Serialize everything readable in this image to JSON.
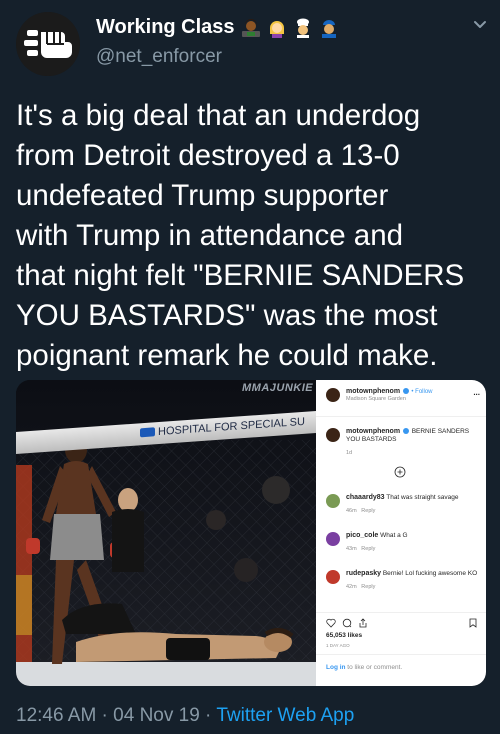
{
  "author": {
    "display_name": "Working Class",
    "handle": "@net_enforcer",
    "name_emojis": [
      "woman-office-worker-emoji",
      "person-emoji",
      "cook-emoji",
      "mechanic-emoji"
    ]
  },
  "tweet": {
    "text": "It's a big deal that an underdog\nfrom Detroit destroyed a 13-0\nundefeated Trump supporter\nwith Trump in attendance and\nthat night felt \"BERNIE SANDERS\nYOU BASTARDS\" was the most\npoignant remark he could make.",
    "timestamp": "12:46 AM · 04 Nov 19",
    "separator": " · ",
    "source": "Twitter Web App"
  },
  "media": {
    "photo": {
      "watermark": "MMAJUNKIE",
      "banner_text": "HOSPITAL FOR SPECIAL SU"
    },
    "instagram": {
      "post_user": "motownphenom",
      "follow_label": "• Follow",
      "location": "Madison Square Garden",
      "more_label": "...",
      "caption_user": "motownphenom",
      "caption_text": "BERNIE SANDERS YOU BASTARDS",
      "caption_age": "1d",
      "comments": [
        {
          "user": "chaaardy83",
          "text": "That was straight savage",
          "age": "46m",
          "reply": "Reply",
          "avatar_color": "#7a9a54"
        },
        {
          "user": "pico_cole",
          "text": "What a G",
          "age": "43m",
          "reply": "Reply",
          "avatar_color": "#7a3fa1"
        },
        {
          "user": "rudepasky",
          "text": "Bernie! Lol fucking awesome KO",
          "age": "42m",
          "reply": "Reply",
          "avatar_color": "#c0392b"
        }
      ],
      "likes": "65,053 likes",
      "post_age": "1 DAY AGO",
      "login_link": "Log in",
      "login_text": " to like or comment."
    }
  },
  "colors": {
    "background": "#15202b",
    "text": "#ffffff",
    "secondary": "#8899a6",
    "link": "#1da1f2"
  }
}
